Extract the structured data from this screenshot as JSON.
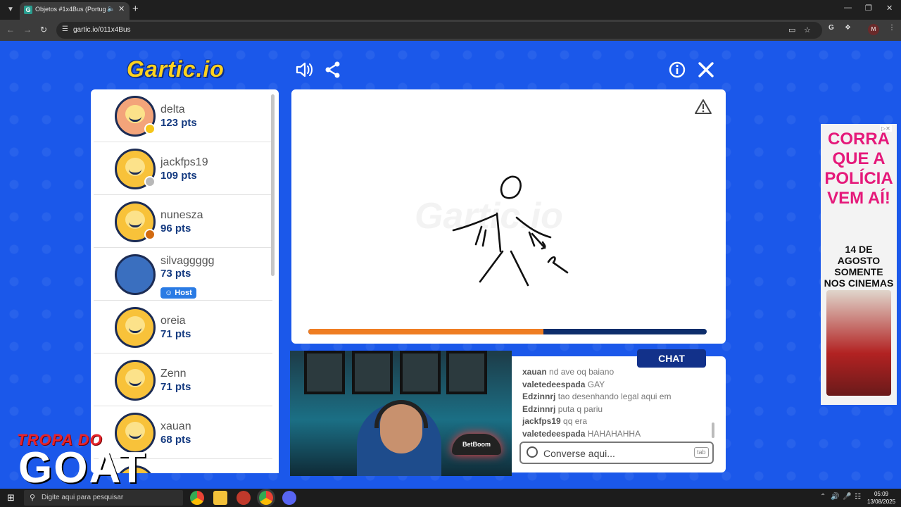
{
  "browser": {
    "tab_title": "Objetos #1x4Bus (Portuguê",
    "url": "gartic.io/011x4Bus"
  },
  "game": {
    "logo_text": "Gartic.io",
    "watermark_text": "Gartic.io",
    "progress_fraction": 0.59,
    "players": [
      {
        "name": "delta",
        "pts": "123 pts",
        "status_color": "#f5c518",
        "avatar": "delta"
      },
      {
        "name": "jackfps19",
        "pts": "109 pts",
        "status_color": "#b8b8b8",
        "avatar": "default"
      },
      {
        "name": "nunesza",
        "pts": "96 pts",
        "status_color": "#d26a10",
        "avatar": "default"
      },
      {
        "name": "silvaggggg",
        "pts": "73 pts",
        "status_color": "",
        "avatar": "photo",
        "host_label": "Host"
      },
      {
        "name": "oreia",
        "pts": "71 pts",
        "status_color": "",
        "avatar": "default"
      },
      {
        "name": "Zenn",
        "pts": "71 pts",
        "status_color": "",
        "avatar": "default"
      },
      {
        "name": "xauan",
        "pts": "68 pts",
        "status_color": "",
        "avatar": "default"
      }
    ]
  },
  "chat": {
    "tab_label": "CHAT",
    "messages": [
      {
        "user": "xauan",
        "text": "nd ave oq baiano"
      },
      {
        "user": "valetedeespada",
        "text": "GAY"
      },
      {
        "user": "Edzinnrj",
        "text": "tao desenhando legal aqui em"
      },
      {
        "user": "Edzinnrj",
        "text": "puta q pariu"
      },
      {
        "user": "jackfps19",
        "text": "qq era"
      },
      {
        "user": "valetedeespada",
        "text": "HAHAHAHHA"
      }
    ],
    "input_placeholder": "Converse aqui...",
    "tab_hint": "tab"
  },
  "overlay": {
    "tropa_text": "TROPA DO",
    "goat_text": "GOAT",
    "lamp_text": "BetBoom"
  },
  "ad": {
    "title": "CORRA QUE A POLÍCIA VEM AÍ!",
    "subtitle": "14 DE AGOSTO SOMENTE NOS CINEMAS"
  },
  "taskbar": {
    "search_placeholder": "Digite aqui para pesquisar",
    "time": "05:09",
    "date": "13/08/2025"
  }
}
